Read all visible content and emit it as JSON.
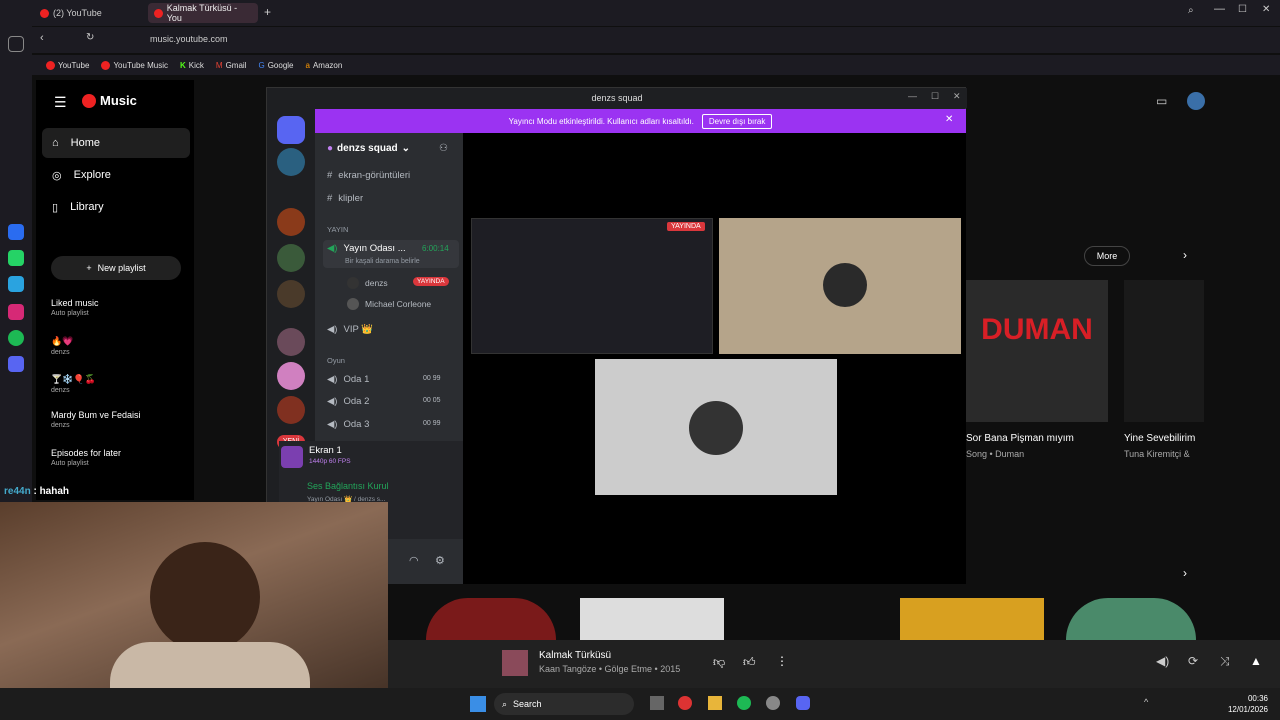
{
  "browser": {
    "tabs": [
      {
        "label": "(2) YouTube"
      },
      {
        "label": "Kalmak Türküsü - You"
      }
    ],
    "url": "music.youtube.com",
    "bookmarks": [
      "YouTube",
      "YouTube Music",
      "Kick",
      "Gmail",
      "Google",
      "Amazon"
    ]
  },
  "ytm": {
    "logo": "Music",
    "nav": [
      "Home",
      "Explore",
      "Library"
    ],
    "new_playlist": "New playlist",
    "playlists": [
      {
        "title": "Liked music",
        "sub": "Auto playlist"
      },
      {
        "title": "🔥💗",
        "sub": "denzs"
      },
      {
        "title": "🍸❄️🎈🍒",
        "sub": "denzs"
      },
      {
        "title": "Mardy Bum ve Fedaisi",
        "sub": "denzs"
      },
      {
        "title": "Episodes for later",
        "sub": "Auto playlist"
      }
    ],
    "more": "More",
    "cards": [
      {
        "title": "Sor Bana Pişman mıyım",
        "sub": "Song • Duman",
        "art": "DUMAN"
      },
      {
        "title": "Yine Sevebilirim",
        "sub": "Tuna Kiremitçi &"
      }
    ]
  },
  "chat": {
    "user": "re44n",
    "msg": "hahah"
  },
  "discord": {
    "title": "denzs squad",
    "banner": "Yayıncı Modu etkinleştirildi. Kullanıcı adları kısaltıldı.",
    "banner_btn": "Devre dışı bırak",
    "server": "denzs squad",
    "channels": [
      "ekran-görüntüleri",
      "klipler"
    ],
    "cat1": "YAYIN",
    "voice": {
      "name": "Yayın Odası ...",
      "time": "6:00:14",
      "status": "Bir kaşali darama belirle"
    },
    "users": [
      {
        "name": "denzs",
        "badge": "YAYINDA"
      },
      {
        "name": "Michael Corleone"
      }
    ],
    "vip": "VIP 👑",
    "cat2": "Oyun",
    "rooms": [
      {
        "name": "Oda 1",
        "a": "00",
        "b": "99"
      },
      {
        "name": "Oda 2",
        "a": "00",
        "b": "05"
      },
      {
        "name": "Oda 3",
        "a": "00",
        "b": "99"
      }
    ],
    "stream": {
      "title": "Ekran 1",
      "sub": "1440p 60 FPS"
    },
    "voice_status": "Ses Bağlantısı Kurul",
    "voice_sub": "Yayın Odası 👑 / denzs s...",
    "live": "YAYINDA",
    "new": "YENİ"
  },
  "player": {
    "title": "Kalmak Türküsü",
    "sub": "Kaan Tangöze • Gölge Etme • 2015"
  },
  "taskbar": {
    "search": "Search",
    "time": "00:36",
    "date": "12/01/2026"
  }
}
